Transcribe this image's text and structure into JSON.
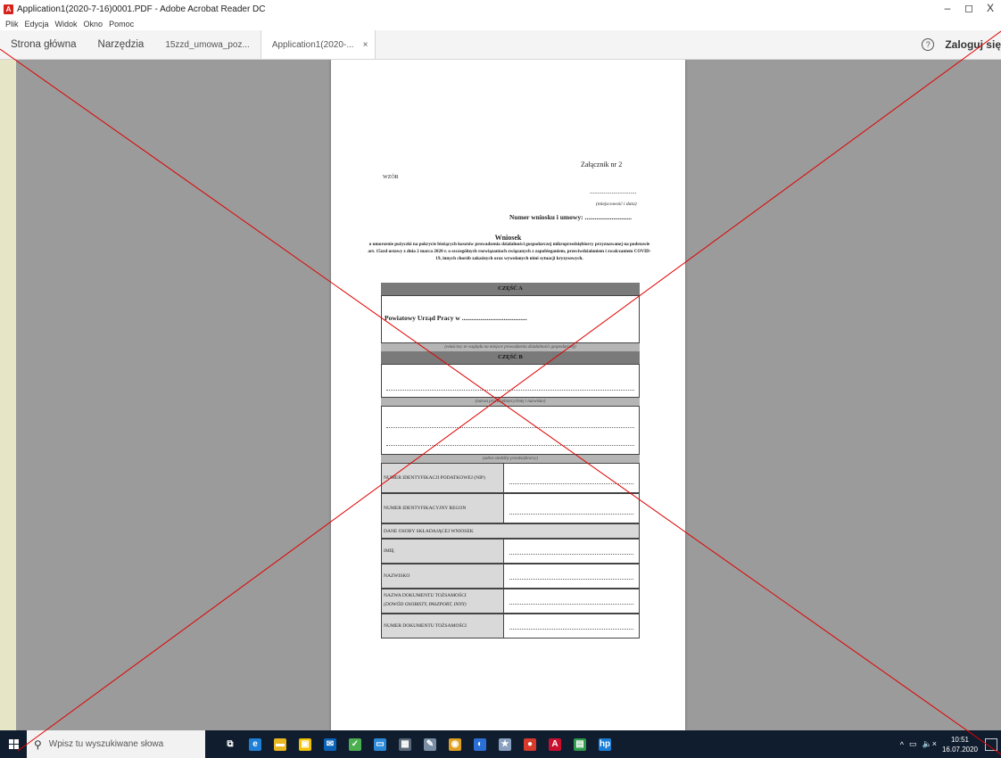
{
  "window": {
    "title": "Application1(2020-7-16)0001.PDF - Adobe Acrobat Reader DC",
    "app_icon_glyph": "A",
    "minimize": "–",
    "maximize": "◻",
    "close": "X"
  },
  "menu": [
    "Plik",
    "Edycja",
    "Widok",
    "Okno",
    "Pomoc"
  ],
  "tabs": {
    "home": "Strona główna",
    "tools": "Narzędzia",
    "doc1": "15zzd_umowa_poz...",
    "doc2": "Application1(2020-...",
    "close_glyph": "×",
    "help_glyph": "?",
    "login": "Zaloguj się"
  },
  "doc": {
    "zalacznik": "Załącznik nr 2",
    "wzor": "WZÓR",
    "dots_place": "..............................",
    "miejscowosc": "(miejscowość i data)",
    "numer": "Numer wniosku i umowy: ............................",
    "wniosek_title": "Wniosek",
    "wniosek_text": "o umorzenie pożyczki na pokrycie bieżących kosztów prowadzenia działalności gospodarczej mikroprzedsiębiorcy przyznawanej na podstawie art. 15zzd ustawy z dnia 2 marca 2020 r. o szczególnych rozwiązaniach związanych z zapobieganiem, przeciwdziałaniem i zwalczaniem COVID-19, innych chorób zakaźnych oraz wywołanych nimi sytuacji kryzysowych.",
    "czesc_a": "CZĘŚĆ A",
    "powiatowy": "Powiatowy Urząd Pracy w .......................................",
    "wlasciwy": "(właściwy ze względu na miejsce prowadzenia działalności gospodarczej)",
    "czesc_b": "CZĘŚĆ B",
    "nazwa_caption": "(nazwa przedsiębiorcy/imię i nazwisko)",
    "adres_caption": "(adres siedziby przedsiębiorcy)",
    "nip": "Numer identyfikacji podatkowej (NIP)",
    "regon": "Numer identyfikacyjny REGON",
    "dane_osoby": "Dane osoby składającej Wniosek",
    "imie": "Imię",
    "nazwisko": "Nazwisko",
    "nazwa_dok": "Nazwa dokumentu tożsamości",
    "nazwa_dok_sub": "(dowód osobisty, paszport, inny)",
    "numer_dok": "Numer dokumentu tożsamości"
  },
  "taskbar": {
    "search_placeholder": "Wpisz tu wyszukiwane słowa",
    "time": "10:51",
    "date": "16.07.2020",
    "tray_arrow": "^",
    "tray_volume": "🔈×"
  },
  "taskbar_icons": [
    {
      "name": "task-view-icon",
      "glyph": "⧉",
      "color": "#0f1d2e"
    },
    {
      "name": "edge-icon",
      "glyph": "e",
      "color": "#1e7fd6"
    },
    {
      "name": "file-explorer-icon",
      "glyph": "▬",
      "color": "#e8b820"
    },
    {
      "name": "store-icon",
      "glyph": "▣",
      "color": "#f2c200"
    },
    {
      "name": "mail-icon",
      "glyph": "✉",
      "color": "#0a63b8"
    },
    {
      "name": "security-icon",
      "glyph": "✓",
      "color": "#4caf50"
    },
    {
      "name": "monitor-icon",
      "glyph": "▭",
      "color": "#2a8ad8"
    },
    {
      "name": "calculator-icon",
      "glyph": "▦",
      "color": "#5a6a7a"
    },
    {
      "name": "paint-icon",
      "glyph": "✎",
      "color": "#7a8fa6"
    },
    {
      "name": "chrome-icon",
      "glyph": "◉",
      "color": "#e0a020"
    },
    {
      "name": "app-icon",
      "glyph": "◐",
      "color": "#2b6fd6"
    },
    {
      "name": "favorites-icon",
      "glyph": "★",
      "color": "#8aa0c0"
    },
    {
      "name": "red-app-icon",
      "glyph": "●",
      "color": "#d63b2b"
    },
    {
      "name": "acrobat-icon",
      "glyph": "A",
      "color": "#c8102e"
    },
    {
      "name": "green-app-icon",
      "glyph": "▤",
      "color": "#2e9a4a"
    },
    {
      "name": "hp-icon",
      "glyph": "hp",
      "color": "#1b7ed6"
    }
  ]
}
